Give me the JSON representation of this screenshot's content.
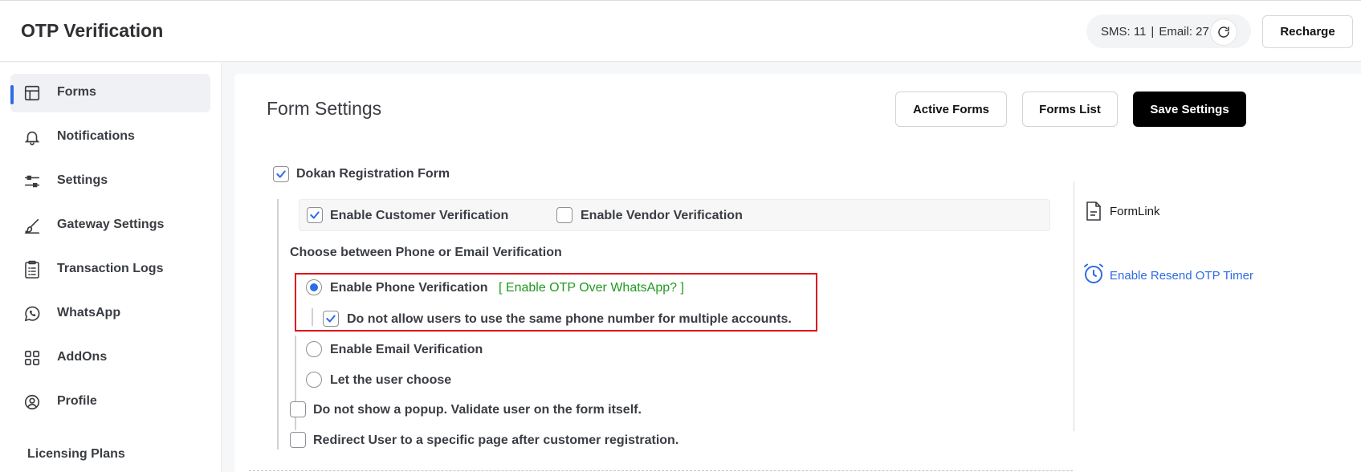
{
  "app": {
    "title": "OTP Verification"
  },
  "credits": {
    "sms_label": "SMS: 11",
    "separator": "|",
    "email_label": "Email: 27"
  },
  "header": {
    "recharge_label": "Recharge"
  },
  "sidebar": {
    "items": [
      {
        "label": "Forms",
        "icon": "forms-layout-icon",
        "active": true
      },
      {
        "label": "Notifications",
        "icon": "bell-icon"
      },
      {
        "label": "Settings",
        "icon": "sliders-icon"
      },
      {
        "label": "Gateway Settings",
        "icon": "brush-icon"
      },
      {
        "label": "Transaction Logs",
        "icon": "clipboard-list-icon"
      },
      {
        "label": "WhatsApp",
        "icon": "whatsapp-icon"
      },
      {
        "label": "AddOns",
        "icon": "grid-icon"
      },
      {
        "label": "Profile",
        "icon": "user-circle-icon"
      }
    ],
    "licensing_label": "Licensing Plans"
  },
  "main": {
    "title": "Form Settings",
    "active_forms_label": "Active Forms",
    "forms_list_label": "Forms List",
    "save_settings_label": "Save Settings",
    "form_name": "Dokan Registration Form",
    "form_checked": true,
    "customer_verification_label": "Enable Customer Verification",
    "customer_verification_checked": true,
    "vendor_verification_label": "Enable Vendor Verification",
    "vendor_verification_checked": false,
    "choose_heading": "Choose between Phone or Email Verification",
    "phone_verification_label": "Enable Phone Verification",
    "whatsapp_link_label": "[ Enable OTP Over WhatsApp? ]",
    "same_phone_label": "Do not allow users to use the same phone number for multiple accounts.",
    "email_verification_label": "Enable Email Verification",
    "user_choose_label": "Let the user choose",
    "no_popup_label": "Do not show a popup. Validate user on the form itself.",
    "redirect_label": "Redirect User to a specific page after customer registration.",
    "formlink_label": "FormLink",
    "resend_timer_label": "Enable Resend OTP Timer"
  },
  "colors": {
    "accent": "#2f6be5",
    "whatsapp_green": "#1f9a1f",
    "highlight_red": "#e0141b",
    "primary_button": "#000000"
  }
}
